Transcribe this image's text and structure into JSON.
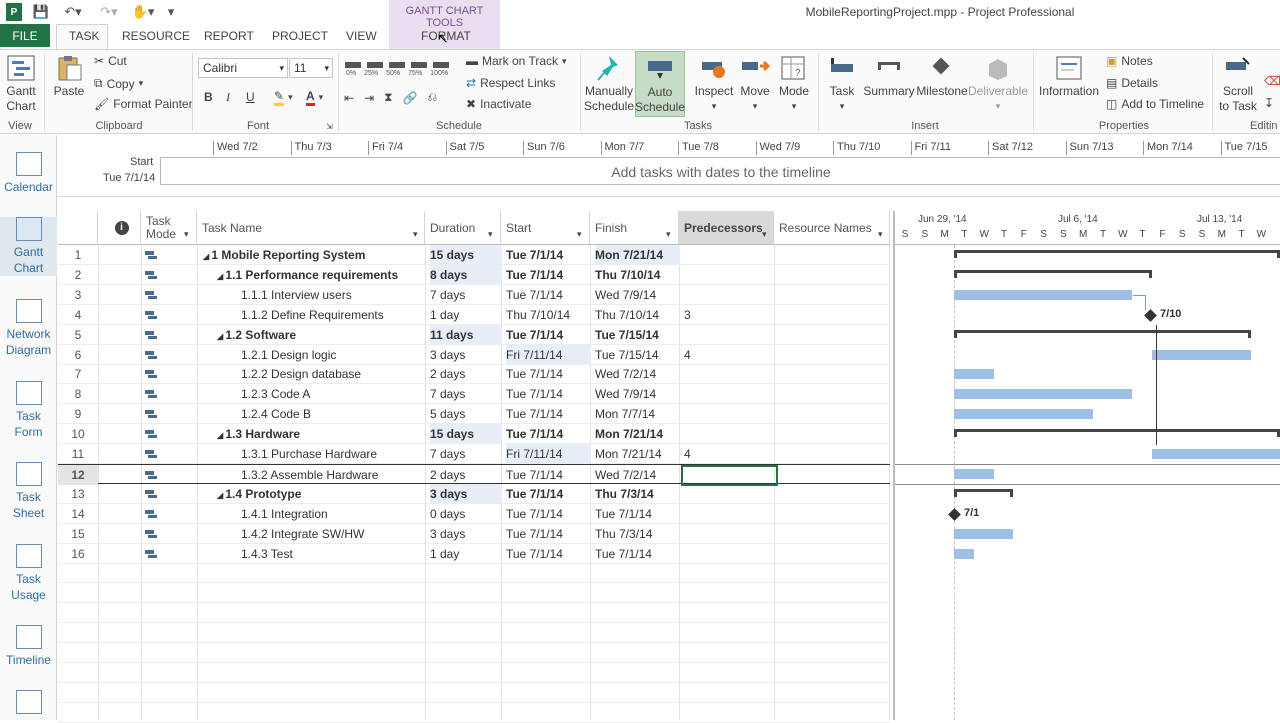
{
  "app": {
    "title": "MobileReportingProject.mpp - Project Professional",
    "context_group": "GANTT CHART TOOLS"
  },
  "tabs": [
    "FILE",
    "TASK",
    "RESOURCE",
    "REPORT",
    "PROJECT",
    "VIEW",
    "FORMAT"
  ],
  "ribbon": {
    "view": {
      "gantt_label": "Gantt",
      "gantt_label2": "Chart",
      "group": "View"
    },
    "clipboard": {
      "paste": "Paste",
      "cut": "Cut",
      "copy": "Copy",
      "format_painter": "Format Painter",
      "group": "Clipboard"
    },
    "font": {
      "name": "Calibri",
      "size": "11",
      "group": "Font"
    },
    "schedule": {
      "mark_on_track": "Mark on Track",
      "respect_links": "Respect Links",
      "inactivate": "Inactivate",
      "group": "Schedule",
      "pct": [
        "0%",
        "25%",
        "50%",
        "75%",
        "100%"
      ]
    },
    "tasks": {
      "manually": "Manually",
      "manually2": "Schedule",
      "auto": "Auto",
      "auto2": "Schedule",
      "inspect": "Inspect",
      "move": "Move",
      "mode": "Mode",
      "group": "Tasks"
    },
    "insert": {
      "task": "Task",
      "summary": "Summary",
      "milestone": "Milestone",
      "deliverable": "Deliverable",
      "group": "Insert"
    },
    "properties": {
      "information": "Information",
      "notes": "Notes",
      "details": "Details",
      "add_to_timeline": "Add to Timeline",
      "group": "Properties"
    },
    "editing": {
      "scroll": "Scroll",
      "scroll2": "to Task",
      "group": "Editin"
    }
  },
  "viewbar": [
    {
      "l1": "Calendar",
      "l2": ""
    },
    {
      "l1": "Gantt",
      "l2": "Chart"
    },
    {
      "l1": "Network",
      "l2": "Diagram"
    },
    {
      "l1": "Task",
      "l2": "Form"
    },
    {
      "l1": "Task",
      "l2": "Sheet"
    },
    {
      "l1": "Task",
      "l2": "Usage"
    },
    {
      "l1": "Timeline",
      "l2": ""
    }
  ],
  "timeline": {
    "start_label": "Start",
    "start_date": "Tue 7/1/14",
    "placeholder": "Add tasks with dates to the timeline",
    "dates": [
      "Wed 7/2",
      "Thu 7/3",
      "Fri 7/4",
      "Sat 7/5",
      "Sun 7/6",
      "Mon 7/7",
      "Tue 7/8",
      "Wed 7/9",
      "Thu 7/10",
      "Fri 7/11",
      "Sat 7/12",
      "Sun 7/13",
      "Mon 7/14",
      "Tue 7/15"
    ]
  },
  "columns": {
    "mode": "Task",
    "mode2": "Mode",
    "name": "Task Name",
    "duration": "Duration",
    "start": "Start",
    "finish": "Finish",
    "pred": "Predecessors",
    "res": "Resource Names"
  },
  "tasks": [
    {
      "id": "1",
      "name": "1 Mobile Reporting System",
      "dur": "15 days",
      "start": "Tue 7/1/14",
      "finish": "Mon 7/21/14",
      "pred": "",
      "lvl": 0,
      "sum": true
    },
    {
      "id": "2",
      "name": "1.1 Performance requirements",
      "dur": "8 days",
      "start": "Tue 7/1/14",
      "finish": "Thu 7/10/14",
      "pred": "",
      "lvl": 1,
      "sum": true
    },
    {
      "id": "3",
      "name": "1.1.1 Interview users",
      "dur": "7 days",
      "start": "Tue 7/1/14",
      "finish": "Wed 7/9/14",
      "pred": "",
      "lvl": 2,
      "sum": false
    },
    {
      "id": "4",
      "name": "1.1.2 Define Requirements",
      "dur": "1 day",
      "start": "Thu 7/10/14",
      "finish": "Thu 7/10/14",
      "pred": "3",
      "lvl": 2,
      "sum": false
    },
    {
      "id": "5",
      "name": "1.2 Software",
      "dur": "11 days",
      "start": "Tue 7/1/14",
      "finish": "Tue 7/15/14",
      "pred": "",
      "lvl": 1,
      "sum": true
    },
    {
      "id": "6",
      "name": "1.2.1 Design logic",
      "dur": "3 days",
      "start": "Fri 7/11/14",
      "finish": "Tue 7/15/14",
      "pred": "4",
      "lvl": 2,
      "sum": false
    },
    {
      "id": "7",
      "name": "1.2.2 Design database",
      "dur": "2 days",
      "start": "Tue 7/1/14",
      "finish": "Wed 7/2/14",
      "pred": "",
      "lvl": 2,
      "sum": false
    },
    {
      "id": "8",
      "name": "1.2.3 Code A",
      "dur": "7 days",
      "start": "Tue 7/1/14",
      "finish": "Wed 7/9/14",
      "pred": "",
      "lvl": 2,
      "sum": false
    },
    {
      "id": "9",
      "name": "1.2.4 Code B",
      "dur": "5 days",
      "start": "Tue 7/1/14",
      "finish": "Mon 7/7/14",
      "pred": "",
      "lvl": 2,
      "sum": false
    },
    {
      "id": "10",
      "name": "1.3 Hardware",
      "dur": "15 days",
      "start": "Tue 7/1/14",
      "finish": "Mon 7/21/14",
      "pred": "",
      "lvl": 1,
      "sum": true
    },
    {
      "id": "11",
      "name": "1.3.1 Purchase Hardware",
      "dur": "7 days",
      "start": "Fri 7/11/14",
      "finish": "Mon 7/21/14",
      "pred": "4",
      "lvl": 2,
      "sum": false
    },
    {
      "id": "12",
      "name": "1.3.2 Assemble Hardware",
      "dur": "2 days",
      "start": "Tue 7/1/14",
      "finish": "Wed 7/2/14",
      "pred": "",
      "lvl": 2,
      "sum": false
    },
    {
      "id": "13",
      "name": "1.4 Prototype",
      "dur": "3 days",
      "start": "Tue 7/1/14",
      "finish": "Thu 7/3/14",
      "pred": "",
      "lvl": 1,
      "sum": true
    },
    {
      "id": "14",
      "name": "1.4.1 Integration",
      "dur": "0 days",
      "start": "Tue 7/1/14",
      "finish": "Tue 7/1/14",
      "pred": "",
      "lvl": 2,
      "sum": false
    },
    {
      "id": "15",
      "name": "1.4.2 Integrate SW/HW",
      "dur": "3 days",
      "start": "Tue 7/1/14",
      "finish": "Thu 7/3/14",
      "pred": "",
      "lvl": 2,
      "sum": false
    },
    {
      "id": "16",
      "name": "1.4.3 Test",
      "dur": "1 day",
      "start": "Tue 7/1/14",
      "finish": "Tue 7/1/14",
      "pred": "",
      "lvl": 2,
      "sum": false
    }
  ],
  "gantt": {
    "weeks": [
      "Jun 29, '14",
      "Jul 6, '14",
      "Jul 13, '14"
    ],
    "days": [
      "S",
      "S",
      "M",
      "T",
      "W",
      "T",
      "F",
      "S",
      "S",
      "M",
      "T",
      "W",
      "T",
      "F",
      "S",
      "S",
      "M",
      "T",
      "W"
    ],
    "milestone_labels": [
      "7/10",
      "7/1"
    ]
  },
  "colors": {
    "accent": "#217346",
    "bar": "#9dbfe6",
    "context": "#7a4f93"
  }
}
